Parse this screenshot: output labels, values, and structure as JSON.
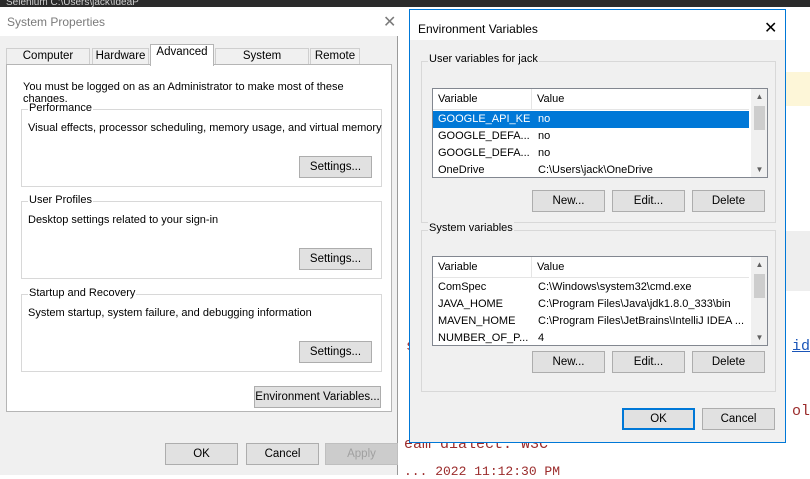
{
  "background": {
    "top_strip_text": "Selenium C:\\Users\\jack\\IdeaP",
    "code_lines": [
      {
        "text": "s",
        "link": false
      },
      {
        "text": "id",
        "link": true
      },
      {
        "text": "ol",
        "link": false
      },
      {
        "text": "eam dialect: W3C",
        "link": false
      },
      {
        "text": "... 2022 11:12:30 PM",
        "link": false
      }
    ]
  },
  "system_properties": {
    "title": "System Properties",
    "close_glyph": "✕",
    "tabs": [
      {
        "label": "Computer Name",
        "active": false
      },
      {
        "label": "Hardware",
        "active": false
      },
      {
        "label": "Advanced",
        "active": true
      },
      {
        "label": "System Protection",
        "active": false
      },
      {
        "label": "Remote",
        "active": false
      }
    ],
    "admin_note": "You must be logged on as an Administrator to make most of these changes.",
    "groups": [
      {
        "label": "Performance",
        "description": "Visual effects, processor scheduling, memory usage, and virtual memory",
        "button": "Settings..."
      },
      {
        "label": "User Profiles",
        "description": "Desktop settings related to your sign-in",
        "button": "Settings..."
      },
      {
        "label": "Startup and Recovery",
        "description": "System startup, system failure, and debugging information",
        "button": "Settings..."
      }
    ],
    "env_button": "Environment Variables...",
    "ok": "OK",
    "cancel": "Cancel",
    "apply": "Apply"
  },
  "environment_variables": {
    "title": "Environment Variables",
    "close_glyph": "✕",
    "user_section": {
      "label": "User variables for jack",
      "columns": [
        "Variable",
        "Value"
      ],
      "rows": [
        {
          "variable": "GOOGLE_API_KEY",
          "value": "no",
          "selected": true
        },
        {
          "variable": "GOOGLE_DEFA...",
          "value": "no",
          "selected": false
        },
        {
          "variable": "GOOGLE_DEFA...",
          "value": "no",
          "selected": false
        },
        {
          "variable": "OneDrive",
          "value": "C:\\Users\\jack\\OneDrive",
          "selected": false
        }
      ],
      "buttons": [
        "New...",
        "Edit...",
        "Delete"
      ]
    },
    "system_section": {
      "label": "System variables",
      "columns": [
        "Variable",
        "Value"
      ],
      "rows": [
        {
          "variable": "ComSpec",
          "value": "C:\\Windows\\system32\\cmd.exe",
          "selected": false
        },
        {
          "variable": "JAVA_HOME",
          "value": "C:\\Program Files\\Java\\jdk1.8.0_333\\bin",
          "selected": false
        },
        {
          "variable": "MAVEN_HOME",
          "value": "C:\\Program Files\\JetBrains\\IntelliJ IDEA ...",
          "selected": false
        },
        {
          "variable": "NUMBER_OF_P...",
          "value": "4",
          "selected": false
        }
      ],
      "buttons": [
        "New...",
        "Edit...",
        "Delete"
      ]
    },
    "ok": "OK",
    "cancel": "Cancel"
  },
  "colors": {
    "accent": "#0078d7",
    "dialog_bg": "#f0f0f0",
    "code_text": "#9b2b2b",
    "code_link": "#1a55b8"
  }
}
